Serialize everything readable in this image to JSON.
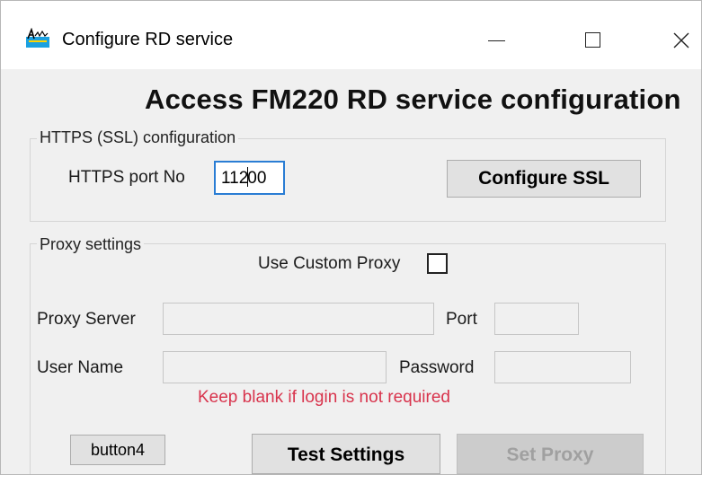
{
  "window": {
    "title": "Configure RD service",
    "controls": {
      "minimize": "minimize",
      "maximize": "maximize",
      "close": "close"
    }
  },
  "heading": "Access FM220 RD service configuration",
  "https_group": {
    "label": "HTTPS (SSL) configuration",
    "port_label": "HTTPS port No",
    "port_value_before_caret": "112",
    "port_value_after_caret": "00",
    "configure_button": "Configure SSL"
  },
  "proxy_group": {
    "label": "Proxy settings",
    "use_custom_proxy_label": "Use Custom Proxy",
    "use_custom_proxy_checked": false,
    "proxy_server_label": "Proxy Server",
    "proxy_server_value": "",
    "port_label": "Port",
    "port_value": "",
    "user_name_label": "User Name",
    "user_name_value": "",
    "password_label": "Password",
    "password_value": "",
    "hint": "Keep blank if login is not required"
  },
  "buttons": {
    "button4": "button4",
    "test_settings": "Test Settings",
    "set_proxy": "Set Proxy"
  },
  "colors": {
    "window_bg": "#f0f0f0",
    "focus_border": "#2a7dd4",
    "hint_text": "#d8334c",
    "disabled_text": "#a0a0a0"
  }
}
